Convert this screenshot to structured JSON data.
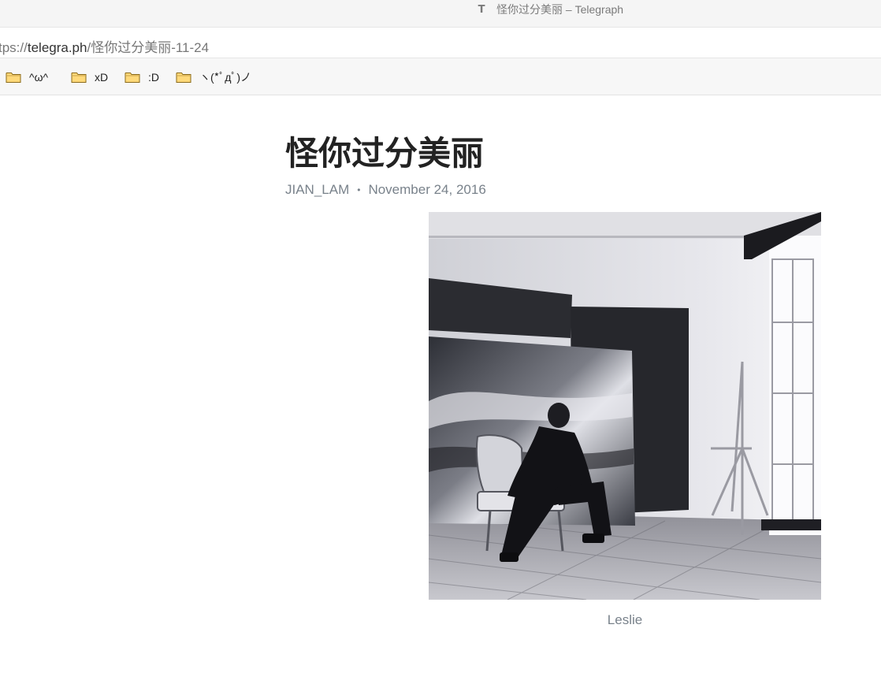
{
  "window": {
    "tab_icon": "telegraph-T-icon",
    "tab_title": "怪你过分美丽 – Telegraph"
  },
  "address": {
    "prefix": "tps://",
    "host": "telegra.ph",
    "path": "/怪你过分美丽-11-24"
  },
  "bookmarks": [
    {
      "label": "^ω^",
      "icon": "folder-icon"
    },
    {
      "label": "xD",
      "icon": "folder-icon"
    },
    {
      "label": ":D",
      "icon": "folder-icon"
    },
    {
      "label": "ヽ(*ﾟдﾟ)ノ",
      "icon": "folder-icon"
    }
  ],
  "article": {
    "title": "怪你过分美丽",
    "author": "JIAN_LAM",
    "separator": "•",
    "date": "November 24, 2016",
    "image_caption": "Leslie"
  },
  "colors": {
    "title": "#222222",
    "meta": "#79828b",
    "folder_fill": "#ffd97a",
    "folder_stroke": "#8a6a1a"
  }
}
